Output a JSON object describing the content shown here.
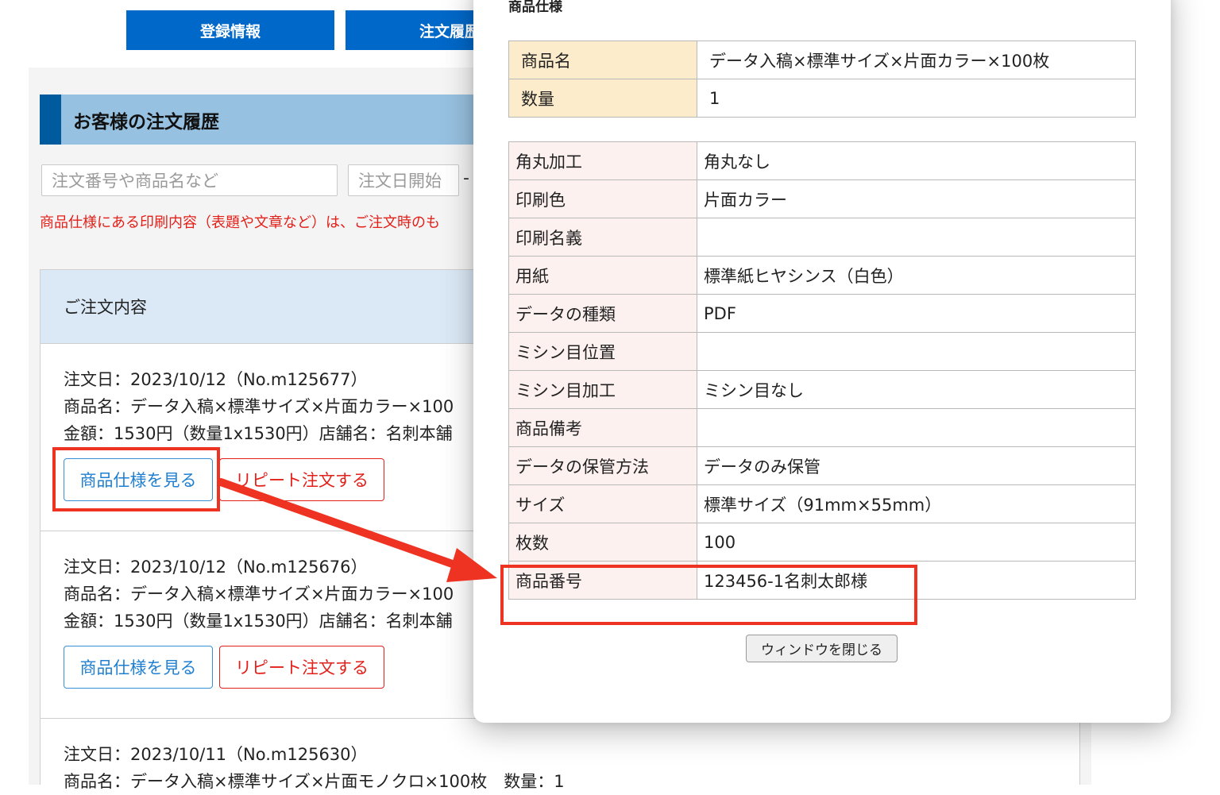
{
  "nav": {
    "registration_label": "登録情報",
    "order_history_label": "注文履歴"
  },
  "history": {
    "title": "お客様の注文履歴",
    "search_placeholder": "注文番号や商品名など",
    "date_start_placeholder": "注文日開始",
    "date_separator": "-",
    "notice": "商品仕様にある印刷内容（表題や文章など）は、ご注文時のも"
  },
  "orders_panel": {
    "heading": "ご注文内容",
    "orders": [
      {
        "date_line": "注文日：2023/10/12（No.m125677）",
        "product_line": "商品名：データ入稿×標準サイズ×片面カラー×100",
        "price_line": "金額：1530円（数量1x1530円）店舗名：名刺本舗",
        "spec_button": "商品仕様を見る",
        "repeat_button": "リピート注文する"
      },
      {
        "date_line": "注文日：2023/10/12（No.m125676）",
        "product_line": "商品名：データ入稿×標準サイズ×片面カラー×100",
        "price_line": "金額：1530円（数量1x1530円）店舗名：名刺本舗",
        "spec_button": "商品仕様を見る",
        "repeat_button": "リピート注文する"
      },
      {
        "date_line": "注文日：2023/10/11（No.m125630）",
        "product_line": "商品名：データ入稿×標準サイズ×片面モノクロ×100枚　数量：1"
      }
    ]
  },
  "modal": {
    "title": "商品仕様",
    "main": [
      {
        "key": "商品名",
        "value": "データ入稿×標準サイズ×片面カラー×100枚"
      },
      {
        "key": "数量",
        "value": "1"
      }
    ],
    "details": [
      {
        "key": "角丸加工",
        "value": "角丸なし"
      },
      {
        "key": "印刷色",
        "value": "片面カラー"
      },
      {
        "key": "印刷名義",
        "value": ""
      },
      {
        "key": "用紙",
        "value": "標準紙ヒヤシンス（白色）"
      },
      {
        "key": "データの種類",
        "value": "PDF"
      },
      {
        "key": "ミシン目位置",
        "value": ""
      },
      {
        "key": "ミシン目加工",
        "value": "ミシン目なし"
      },
      {
        "key": "商品備考",
        "value": ""
      },
      {
        "key": "データの保管方法",
        "value": "データのみ保管"
      },
      {
        "key": "サイズ",
        "value": "標準サイズ（91mm×55mm）"
      },
      {
        "key": "枚数",
        "value": "100"
      },
      {
        "key": "商品番号",
        "value": "123456-1名刺太郎様"
      }
    ],
    "close_button": "ウィンドウを閉じる"
  },
  "colors": {
    "nav_blue": "#0068c8",
    "header_blue": "#97c1e0",
    "notice_red": "#e2201a",
    "annotation_red": "#ee3322"
  }
}
